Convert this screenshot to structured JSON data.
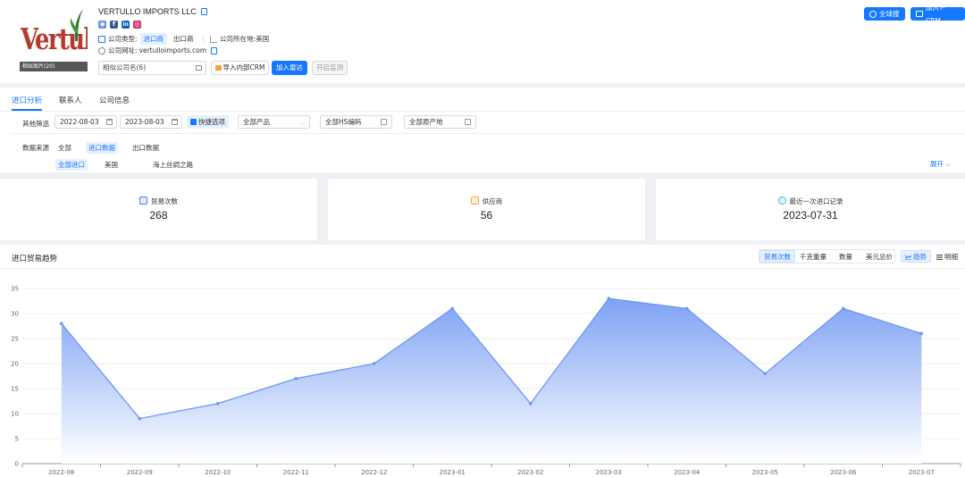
{
  "company": {
    "name": "VERTULLO IMPORTS LLC",
    "logo_text": "Vertullo",
    "logo_caption": "相似图片(20)",
    "type_label": "公司类型:",
    "type_tags": [
      "进口商",
      "出口商"
    ],
    "location_label": "公司所在地:",
    "location": "美国",
    "website_label": "公司网址:",
    "website": "vertulloimports.com",
    "socials": [
      "web",
      "facebook",
      "linkedin",
      "instagram"
    ]
  },
  "actions": {
    "similar_placeholder": "相似公司名(6)",
    "import_crm": "导入内部CRM",
    "add_favorite": "加入雷达",
    "monitor": "开启监测",
    "global_search": "全球搜",
    "add_tcrm": "加入T-CRM"
  },
  "tabs": [
    "进口分析",
    "联系人",
    "公司信息"
  ],
  "filters": {
    "other_label": "其他筛选",
    "date_start": "2022-08-03",
    "date_end": "2023-08-03",
    "quick_option": "快捷选项",
    "product": "全部产品",
    "hs_code": "全部HS编码",
    "origin": "全部原产地",
    "source_label": "数据来源",
    "sources": [
      "全部",
      "进口数据",
      "出口数据"
    ],
    "sub_sources": [
      "全部进口",
      "美国",
      "海上丝绸之路"
    ],
    "expand": "展开"
  },
  "stats": [
    {
      "label": "贸易次数",
      "value": "268",
      "color": "#4a7cf6"
    },
    {
      "label": "供应商",
      "value": "56",
      "color": "#f5a33a"
    },
    {
      "label": "最近一次进口记录",
      "value": "2023-07-31",
      "color": "#3bb8d6"
    }
  ],
  "chart_section": {
    "title": "进口贸易趋势",
    "metrics": [
      "贸易次数",
      "千克重量",
      "数量",
      "美元总价"
    ],
    "views": [
      "趋势",
      "明细"
    ]
  },
  "chart_data": {
    "type": "area",
    "categories": [
      "2022-08",
      "2022-09",
      "2022-10",
      "2022-11",
      "2022-12",
      "2023-01",
      "2023-02",
      "2023-03",
      "2023-04",
      "2023-05",
      "2023-06",
      "2023-07"
    ],
    "values": [
      28,
      9,
      12,
      17,
      20,
      31,
      12,
      33,
      31,
      18,
      31,
      26
    ],
    "ylim": [
      0,
      35
    ],
    "yticks": [
      0,
      5,
      10,
      15,
      20,
      25,
      30,
      35
    ],
    "grid": true,
    "line_color": "#6b97f0",
    "fill_top": "#7ea2f4",
    "fill_bottom": "#ffffff"
  }
}
